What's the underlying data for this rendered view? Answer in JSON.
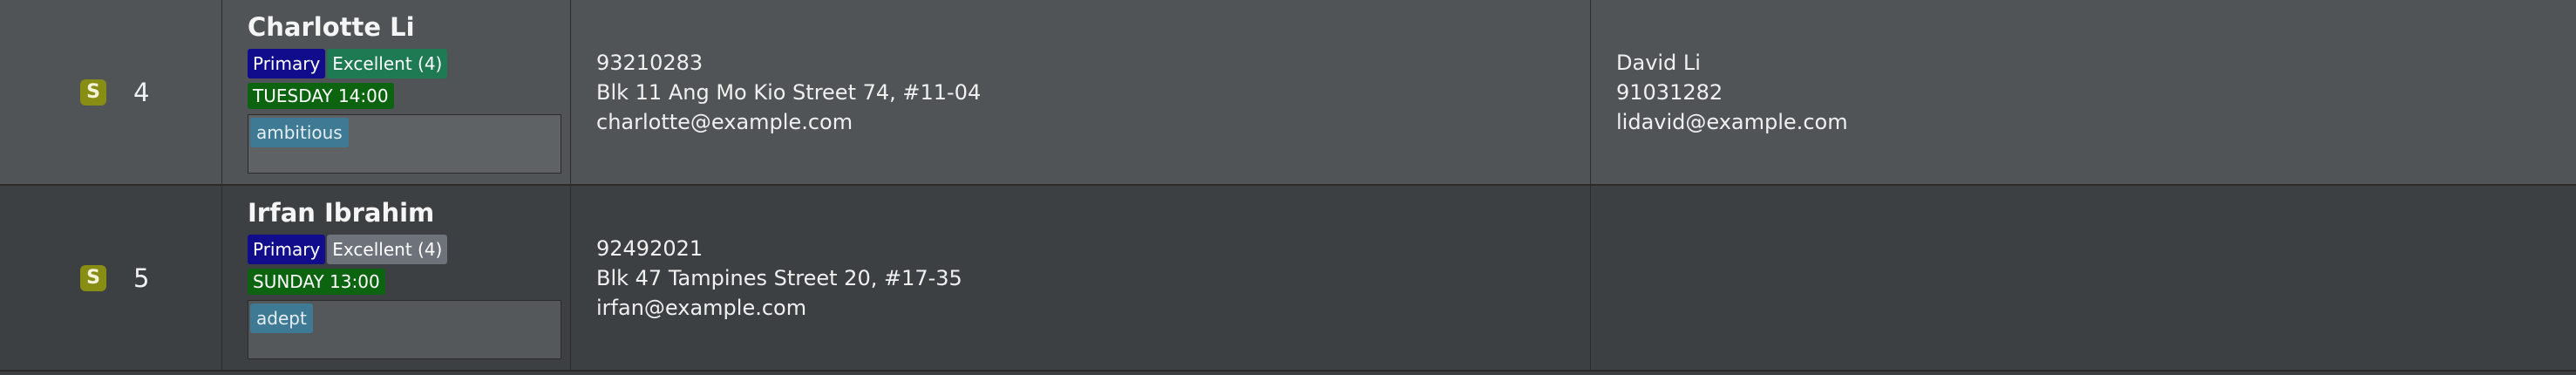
{
  "rows": [
    {
      "badge": "S",
      "index": "4",
      "name": "Charlotte Li",
      "level": "Primary",
      "grade": "Excellent (4)",
      "grade_color": "#1e7a53",
      "schedule": "TUESDAY 14:00",
      "note_tag": "ambitious",
      "phone": "93210283",
      "address": "Blk 11 Ang Mo Kio Street 74, #11-04",
      "email": "charlotte@example.com",
      "parent": {
        "name": "David Li",
        "phone": "91031282",
        "email": "lidavid@example.com"
      }
    },
    {
      "badge": "S",
      "index": "5",
      "name": "Irfan Ibrahim",
      "level": "Primary",
      "grade": "Excellent (4)",
      "grade_color": "#6d727b",
      "schedule": "SUNDAY 13:00",
      "note_tag": "adept",
      "phone": "92492021",
      "address": "Blk 47 Tampines Street 20, #17-35",
      "email": "irfan@example.com",
      "parent": {
        "name": "",
        "phone": "",
        "email": ""
      }
    }
  ],
  "colors": {
    "row_odd": "#505457",
    "row_even": "#3d4043",
    "badge": "#888d14",
    "primary_tag": "#100c8c",
    "schedule_tag": "#0d6410",
    "note_tag": "#3e7a93"
  }
}
